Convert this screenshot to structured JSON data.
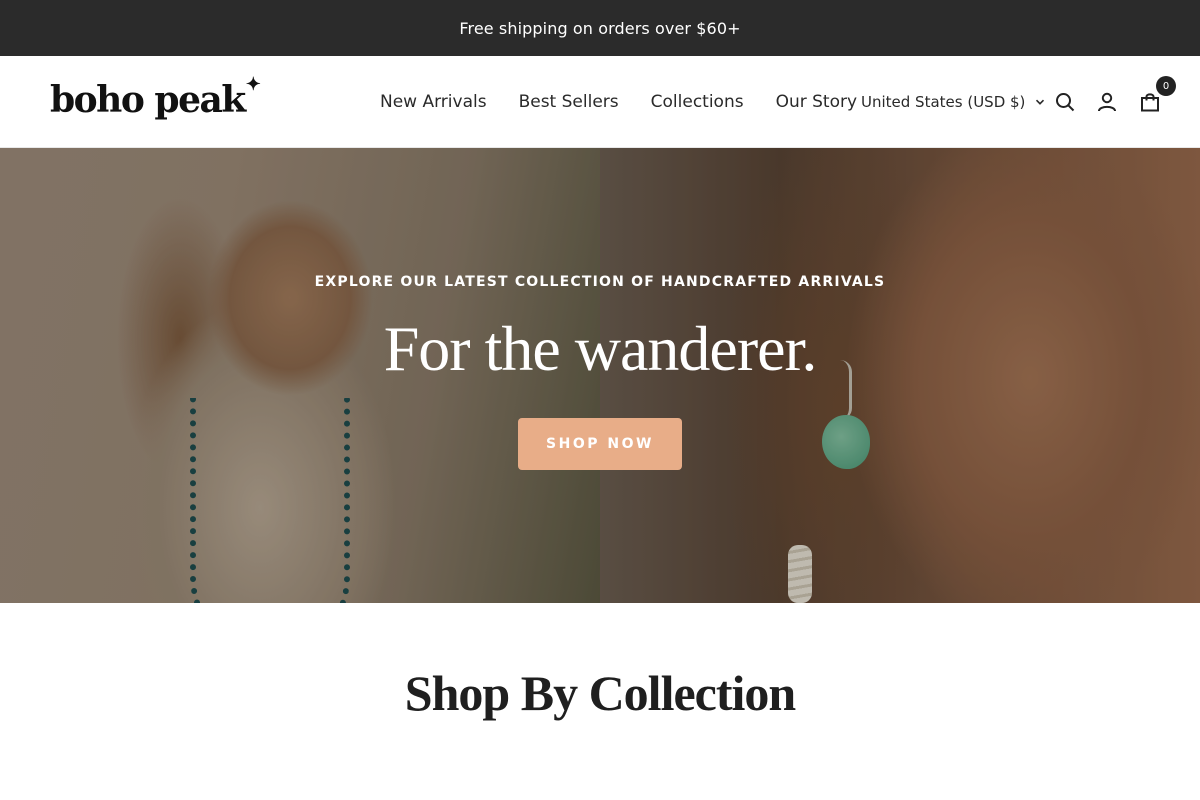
{
  "announcement": {
    "text": "Free shipping on orders over $60+"
  },
  "header": {
    "logo_text": "boho peak",
    "logo_mark": "✦",
    "nav": [
      {
        "label": "New Arrivals"
      },
      {
        "label": "Best Sellers"
      },
      {
        "label": "Collections"
      },
      {
        "label": "Our Story"
      }
    ],
    "currency_label": "United States (USD $)",
    "cart_count": "0",
    "icons": [
      "search-icon",
      "account-icon",
      "cart-icon",
      "chevron-down-icon"
    ]
  },
  "hero": {
    "eyebrow": "EXPLORE OUR LATEST COLLECTION OF HANDCRAFTED ARRIVALS",
    "title": "For the wanderer.",
    "cta_label": "SHOP NOW"
  },
  "collections": {
    "heading": "Shop By Collection"
  },
  "colors": {
    "announcement_bg": "#2b2b2b",
    "cta_bg": "#e8ad88",
    "text_dark": "#222222"
  }
}
